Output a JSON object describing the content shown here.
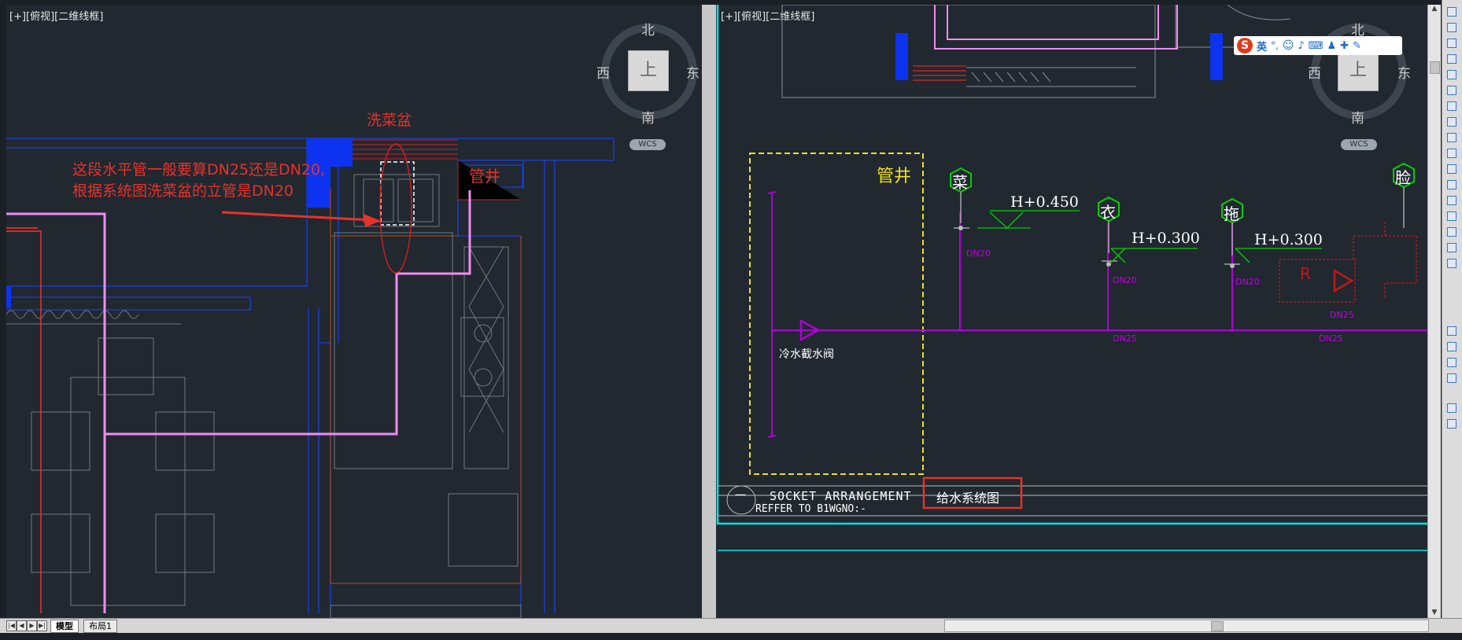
{
  "left_viewport": {
    "title": "[+][俯视][二维线框]",
    "compass": {
      "north": "北",
      "south": "南",
      "west": "西",
      "east": "东",
      "center": "上"
    },
    "wcs": "WCS",
    "labels": {
      "sink": "洗菜盆",
      "shaft": "管井",
      "question_line1": "这段水平管一般要算DN25还是DN20,",
      "question_line2": "根据系统图洗菜盆的立管是DN20"
    }
  },
  "right_viewport": {
    "title": "[+][俯视][二维线框]",
    "compass": {
      "north": "北",
      "south": "南",
      "west": "西",
      "east": "东",
      "center": "上"
    },
    "wcs": "WCS",
    "labels": {
      "shaft": "管井",
      "valve": "冷水截水阀",
      "fixture_cai": "菜",
      "fixture_yi": "衣",
      "fixture_tuo": "拖",
      "fixture_lian": "脸",
      "h1": "H+0.450",
      "h2": "H+0.300",
      "h3": "H+0.300",
      "dn20_a": "DN20",
      "dn20_b": "DN20",
      "dn20_c": "DN20",
      "dn25_a": "DN25",
      "dn25_b": "DN25",
      "dn25_c": "DN25",
      "r_mark": "R",
      "title_block_line1": "SOCKET ARRANGEMENT",
      "title_block_line2": "REFFER TO B1WGNO:-",
      "title_block_symbol": "一",
      "title_block_name": "给水系统图"
    }
  },
  "ime_bar": {
    "logo": "S",
    "lang": "英",
    "punct": "°,"
  },
  "bottom_tabs": {
    "model": "模型",
    "layout1": "布局1"
  },
  "colors": {
    "background": "#212830",
    "red_annotation": "#e8322a",
    "magenta_pipe": "#b000d8",
    "cyan_frame": "#00e0e8",
    "blue_wall": "#1a3fe0",
    "yellow_shaft": "#f0e020",
    "green_symbol": "#00d000"
  }
}
